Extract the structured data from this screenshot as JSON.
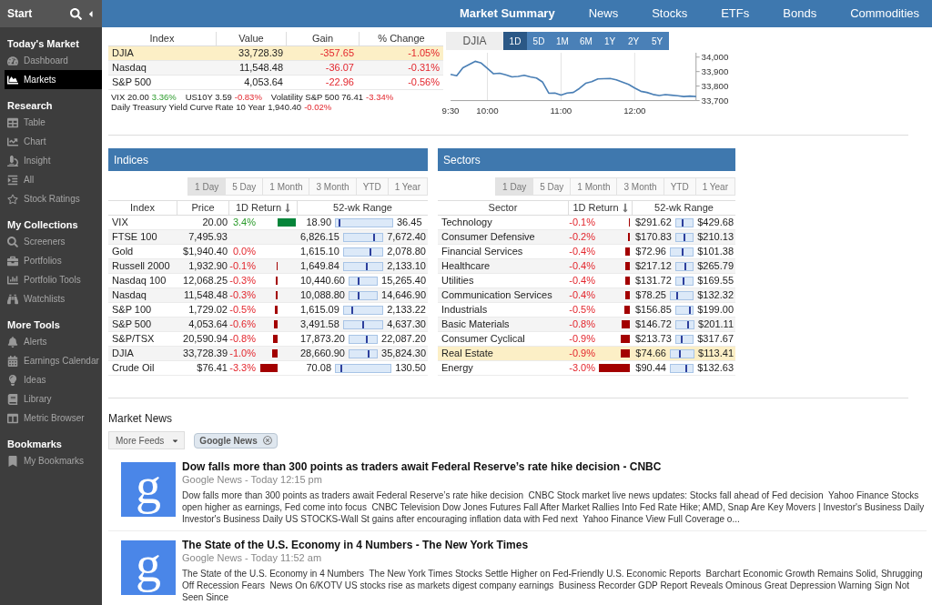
{
  "sidebar": {
    "header": {
      "title": "Start"
    },
    "sections": [
      {
        "title": "Today's Market",
        "items": [
          {
            "label": "Dashboard",
            "selected": false
          },
          {
            "label": "Markets",
            "selected": true
          }
        ]
      },
      {
        "title": "Research",
        "items": [
          {
            "label": "Table",
            "selected": false
          },
          {
            "label": "Chart",
            "selected": false
          },
          {
            "label": "Insight",
            "selected": false
          },
          {
            "label": "All",
            "selected": false
          },
          {
            "label": "Stock Ratings",
            "selected": false
          }
        ]
      },
      {
        "title": "My Collections",
        "items": [
          {
            "label": "Screeners",
            "selected": false
          },
          {
            "label": "Portfolios",
            "selected": false
          },
          {
            "label": "Portfolio Tools",
            "selected": false
          },
          {
            "label": "Watchlists",
            "selected": false
          }
        ]
      },
      {
        "title": "More Tools",
        "items": [
          {
            "label": "Alerts",
            "selected": false
          },
          {
            "label": "Earnings Calendar",
            "selected": false
          },
          {
            "label": "Ideas",
            "selected": false
          },
          {
            "label": "Library",
            "selected": false
          },
          {
            "label": "Metric Browser",
            "selected": false
          }
        ]
      },
      {
        "title": "Bookmarks",
        "items": [
          {
            "label": "My Bookmarks",
            "selected": false
          }
        ]
      }
    ]
  },
  "nav": {
    "items": [
      {
        "label": "Market Summary",
        "selected": true
      },
      {
        "label": "News",
        "selected": false
      },
      {
        "label": "Stocks",
        "selected": false
      },
      {
        "label": "ETFs",
        "selected": false
      },
      {
        "label": "Bonds",
        "selected": false
      },
      {
        "label": "Commodities",
        "selected": false
      }
    ]
  },
  "summary": {
    "columns": [
      "Index",
      "Value",
      "Gain",
      "% Change"
    ],
    "rows": [
      {
        "name": "DJIA",
        "value": "33,728.39",
        "gain": "-357.65",
        "change": "-1.05%",
        "negative": true,
        "selected": true
      },
      {
        "name": "Nasdaq",
        "value": "11,548.48",
        "gain": "-36.07",
        "change": "-0.31%",
        "negative": true,
        "selected": false
      },
      {
        "name": "S&P 500",
        "value": "4,053.64",
        "gain": "-22.96",
        "change": "-0.56%",
        "negative": true,
        "selected": false
      }
    ],
    "quotes": [
      {
        "label": "VIX 20.00",
        "change": "3.36%",
        "negative": false
      },
      {
        "label": "US10Y 3.59",
        "change": "-0.83%",
        "negative": true
      },
      {
        "label": "Volatility S&P 500 76.41",
        "change": "-3.34%",
        "negative": true
      },
      {
        "label": "Daily Treasury Yield Curve Rate 10 Year 1,940.40",
        "change": "-0.02%",
        "negative": true
      }
    ]
  },
  "chart": {
    "ranges": [
      {
        "label": "1D",
        "selected": true
      },
      {
        "label": "5D",
        "selected": false
      },
      {
        "label": "1M",
        "selected": false
      },
      {
        "label": "6M",
        "selected": false
      },
      {
        "label": "1Y",
        "selected": false
      },
      {
        "label": "2Y",
        "selected": false
      },
      {
        "label": "5Y",
        "selected": false
      }
    ],
    "chart_data": {
      "type": "line",
      "grid": true,
      "categories": [
        "9:30",
        null,
        null,
        null,
        null,
        null,
        "10:00",
        null,
        null,
        null,
        null,
        null,
        null,
        null,
        null,
        null,
        null,
        null,
        "11:00",
        null,
        null,
        null,
        null,
        null,
        null,
        null,
        null,
        null,
        null,
        null,
        "12:00",
        null,
        null,
        null,
        null,
        null,
        null,
        null,
        null,
        null,
        null
      ],
      "series": [
        {
          "name": "DJIA",
          "color": "#4a7fb5",
          "values": [
            33881,
            33871,
            33926,
            33948,
            33971,
            33959,
            33922,
            33885,
            33889,
            33878,
            33864,
            33867,
            33875,
            33863,
            33856,
            33827,
            33751,
            33752,
            33738,
            33752,
            33756,
            33784,
            33819,
            33831,
            33849,
            33851,
            33852,
            33843,
            33827,
            33811,
            33787,
            33764,
            33756,
            33742,
            33735,
            33741,
            33737,
            33733,
            33728,
            33731,
            33728
          ]
        }
      ],
      "ylim": [
        33700,
        34030
      ],
      "yticks": [
        {
          "value": 34000,
          "label": "34,000"
        },
        {
          "value": 33900,
          "label": "33,900"
        },
        {
          "value": 33800,
          "label": "33,800"
        },
        {
          "value": 33700,
          "label": "33,700"
        }
      ]
    }
  },
  "indices": {
    "title": "Indices",
    "periods": [
      {
        "label": "1 Day",
        "selected": true
      },
      {
        "label": "5 Day",
        "selected": false
      },
      {
        "label": "1 Month",
        "selected": false
      },
      {
        "label": "3 Month",
        "selected": false
      },
      {
        "label": "YTD",
        "selected": false
      },
      {
        "label": "1 Year",
        "selected": false
      }
    ],
    "columns": [
      {
        "label": "Index",
        "sorted": false
      },
      {
        "label": "Price",
        "sorted": false
      },
      {
        "label": "1D Return",
        "sorted": true
      },
      {
        "label": "52-wk Range",
        "sorted": false
      }
    ],
    "rows": [
      {
        "name": "VIX",
        "price": "20.00",
        "return": {
          "text": "3.4%",
          "negative": false
        },
        "range": {
          "low": "18.90",
          "high": "36.45",
          "level": 0.06
        },
        "selected": false
      },
      {
        "name": "FTSE 100",
        "price": "7,495.93",
        "range": {
          "low": "6,826.15",
          "high": "7,672.40",
          "level": 0.79
        },
        "selected": false
      },
      {
        "name": "Gold",
        "price": "$1,940.40",
        "return": {
          "text": "0.0%",
          "negative": true
        },
        "range": {
          "low": "1,615.10",
          "high": "2,078.80",
          "level": 0.7
        },
        "selected": false
      },
      {
        "name": "Russell 2000",
        "price": "1,932.90",
        "return": {
          "text": "-0.1%",
          "negative": true
        },
        "range": {
          "low": "1,649.84",
          "high": "2,133.10",
          "level": 0.59
        },
        "selected": false
      },
      {
        "name": "Nasdaq 100",
        "price": "12,068.25",
        "return": {
          "text": "-0.3%",
          "negative": true
        },
        "range": {
          "low": "10,440.60",
          "high": "15,265.40",
          "level": 0.34
        },
        "selected": false
      },
      {
        "name": "Nasdaq",
        "price": "11,548.48",
        "return": {
          "text": "-0.3%",
          "negative": true
        },
        "range": {
          "low": "10,088.80",
          "high": "14,646.90",
          "level": 0.32
        },
        "selected": false
      },
      {
        "name": "S&P 100",
        "price": "1,729.02",
        "return": {
          "text": "-0.5%",
          "negative": true
        },
        "range": {
          "low": "1,615.09",
          "high": "2,133.22",
          "level": 0.22
        },
        "selected": false
      },
      {
        "name": "S&P 500",
        "price": "4,053.64",
        "return": {
          "text": "-0.6%",
          "negative": true
        },
        "range": {
          "low": "3,491.58",
          "high": "4,637.30",
          "level": 0.49
        },
        "selected": false
      },
      {
        "name": "S&P/TSX",
        "price": "20,590.94",
        "return": {
          "text": "-0.8%",
          "negative": true
        },
        "range": {
          "low": "17,873.20",
          "high": "22,087.20",
          "level": 0.64
        },
        "selected": false
      },
      {
        "name": "DJIA",
        "price": "33,728.39",
        "return": {
          "text": "-1.0%",
          "negative": true
        },
        "range": {
          "low": "28,660.90",
          "high": "35,824.30",
          "level": 0.71
        },
        "selected": false
      },
      {
        "name": "Crude Oil",
        "price": "$76.41",
        "return": {
          "text": "-3.3%",
          "negative": true
        },
        "range": {
          "low": "70.08",
          "high": "130.50",
          "level": 0.1
        },
        "selected": false
      }
    ]
  },
  "sectors": {
    "title": "Sectors",
    "periods": [
      {
        "label": "1 Day",
        "selected": true
      },
      {
        "label": "5 Day",
        "selected": false
      },
      {
        "label": "1 Month",
        "selected": false
      },
      {
        "label": "3 Month",
        "selected": false
      },
      {
        "label": "YTD",
        "selected": false
      },
      {
        "label": "1 Year",
        "selected": false
      }
    ],
    "columns": [
      {
        "label": "Sector",
        "sorted": false
      },
      {
        "label": "1D Return",
        "sorted": true
      },
      {
        "label": "52-wk Range",
        "sorted": false
      }
    ],
    "rows": [
      {
        "name": "Technology",
        "return": {
          "text": "-0.1%",
          "negative": true
        },
        "range": {
          "low": "$291.62",
          "high": "$429.68",
          "level": 0.39
        },
        "selected": false
      },
      {
        "name": "Consumer Defensive",
        "return": {
          "text": "-0.2%",
          "negative": true
        },
        "range": {
          "low": "$170.83",
          "high": "$210.13",
          "level": 0.49
        },
        "selected": false
      },
      {
        "name": "Financial Services",
        "return": {
          "text": "-0.4%",
          "negative": true
        },
        "range": {
          "low": "$72.96",
          "high": "$101.38",
          "level": 0.55
        },
        "selected": false
      },
      {
        "name": "Healthcare",
        "return": {
          "text": "-0.4%",
          "negative": true
        },
        "range": {
          "low": "$217.12",
          "high": "$265.79",
          "level": 0.54
        },
        "selected": false
      },
      {
        "name": "Utilities",
        "return": {
          "text": "-0.4%",
          "negative": true
        },
        "range": {
          "low": "$131.72",
          "high": "$169.55",
          "level": 0.47
        },
        "selected": false
      },
      {
        "name": "Communication Services",
        "return": {
          "text": "-0.4%",
          "negative": true
        },
        "range": {
          "low": "$78.25",
          "high": "$132.32",
          "level": 0.28
        },
        "selected": false
      },
      {
        "name": "Industrials",
        "return": {
          "text": "-0.5%",
          "negative": true
        },
        "range": {
          "low": "$156.85",
          "high": "$199.00",
          "level": 0.8
        },
        "selected": false
      },
      {
        "name": "Basic Materials",
        "return": {
          "text": "-0.8%",
          "negative": true
        },
        "range": {
          "low": "$146.72",
          "high": "$201.11",
          "level": 0.69
        },
        "selected": false
      },
      {
        "name": "Consumer Cyclical",
        "return": {
          "text": "-0.9%",
          "negative": true
        },
        "range": {
          "low": "$213.73",
          "high": "$317.67",
          "level": 0.33
        },
        "selected": false
      },
      {
        "name": "Real Estate",
        "return": {
          "text": "-0.9%",
          "negative": true
        },
        "range": {
          "low": "$74.66",
          "high": "$113.41",
          "level": 0.38
        },
        "selected": true
      },
      {
        "name": "Energy",
        "return": {
          "text": "-3.0%",
          "negative": true
        },
        "range": {
          "low": "$90.44",
          "high": "$132.63",
          "level": 0.7
        },
        "selected": false
      }
    ]
  },
  "news": {
    "title": "Market News",
    "feeds_button": "More Feeds",
    "filters": [
      {
        "label": "Google News"
      }
    ],
    "items": [
      {
        "logo": "g",
        "title": "Dow falls more than 300 points as traders await Federal Reserve’s rate hike decision - CNBC",
        "source": "Google News - Today 12:15 pm",
        "summary": "Dow falls more than 300 points as traders await Federal Reserve’s rate hike decision  CNBC Stock market live news updates: Stocks fall ahead of Fed decision  Yahoo Finance Stocks open higher as earnings, Fed come into focus  CNBC Television Dow Jones Futures Fall After Market Rallies Into Fed Rate Hike; AMD, Snap Are Key Movers | Investor's Business Daily  Investor's Business Daily US STOCKS-Wall St gains after encouraging inflation data with Fed next  Yahoo Finance View Full Coverage o..."
      },
      {
        "logo": "g",
        "title": "The State of the U.S. Economy in 4 Numbers - The New York Times",
        "source": "Google News - Today 11:52 am",
        "summary": "The State of the U.S. Economy in 4 Numbers  The New York Times Stocks Settle Higher on Fed-Friendly U.S. Economic Reports  Barchart Economic Growth Remains Solid, Shrugging Off Recession Fears  News On 6/KOTV US stocks rise as markets digest company earnings  Business Recorder GDP Report Reveals Ominous Great Depression Warning Sign Not Seen Since"
      }
    ]
  }
}
